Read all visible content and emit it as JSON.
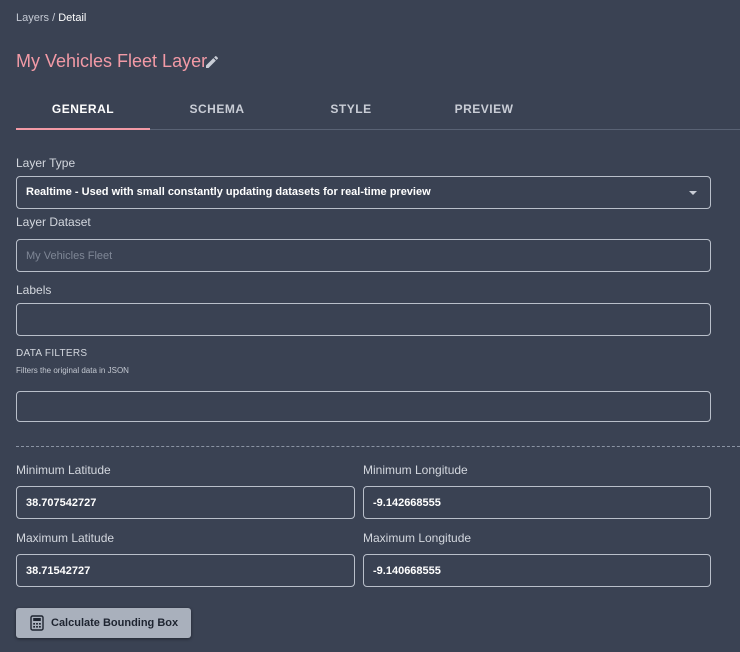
{
  "breadcrumb": {
    "parent": "Layers",
    "separator": " / ",
    "current": "Detail"
  },
  "page": {
    "title": "My Vehicles Fleet Layer",
    "edit_icon": "pencil-icon",
    "accent_color": "#f29aa6"
  },
  "tabs": [
    {
      "label": "GENERAL",
      "active": true
    },
    {
      "label": "SCHEMA",
      "active": false
    },
    {
      "label": "STYLE",
      "active": false
    },
    {
      "label": "PREVIEW",
      "active": false
    }
  ],
  "form": {
    "layer_type": {
      "label": "Layer Type",
      "value": "Realtime - Used with small constantly updating datasets for real-time preview"
    },
    "layer_dataset": {
      "label": "Layer Dataset",
      "value": "",
      "placeholder": "My Vehicles Fleet"
    },
    "labels": {
      "label": "Labels",
      "value": ""
    },
    "data_filters": {
      "label": "DATA FILTERS",
      "hint": "Filters the original data in JSON",
      "value": ""
    },
    "min_latitude": {
      "label": "Minimum Latitude",
      "value": "38.707542727"
    },
    "min_longitude": {
      "label": "Minimum Longitude",
      "value": "-9.142668555"
    },
    "max_latitude": {
      "label": "Maximum Latitude",
      "value": "38.71542727"
    },
    "max_longitude": {
      "label": "Maximum Longitude",
      "value": "-9.140668555"
    }
  },
  "actions": {
    "calculate_label": "Calculate Bounding Box",
    "calculate_icon": "calculator-icon"
  }
}
